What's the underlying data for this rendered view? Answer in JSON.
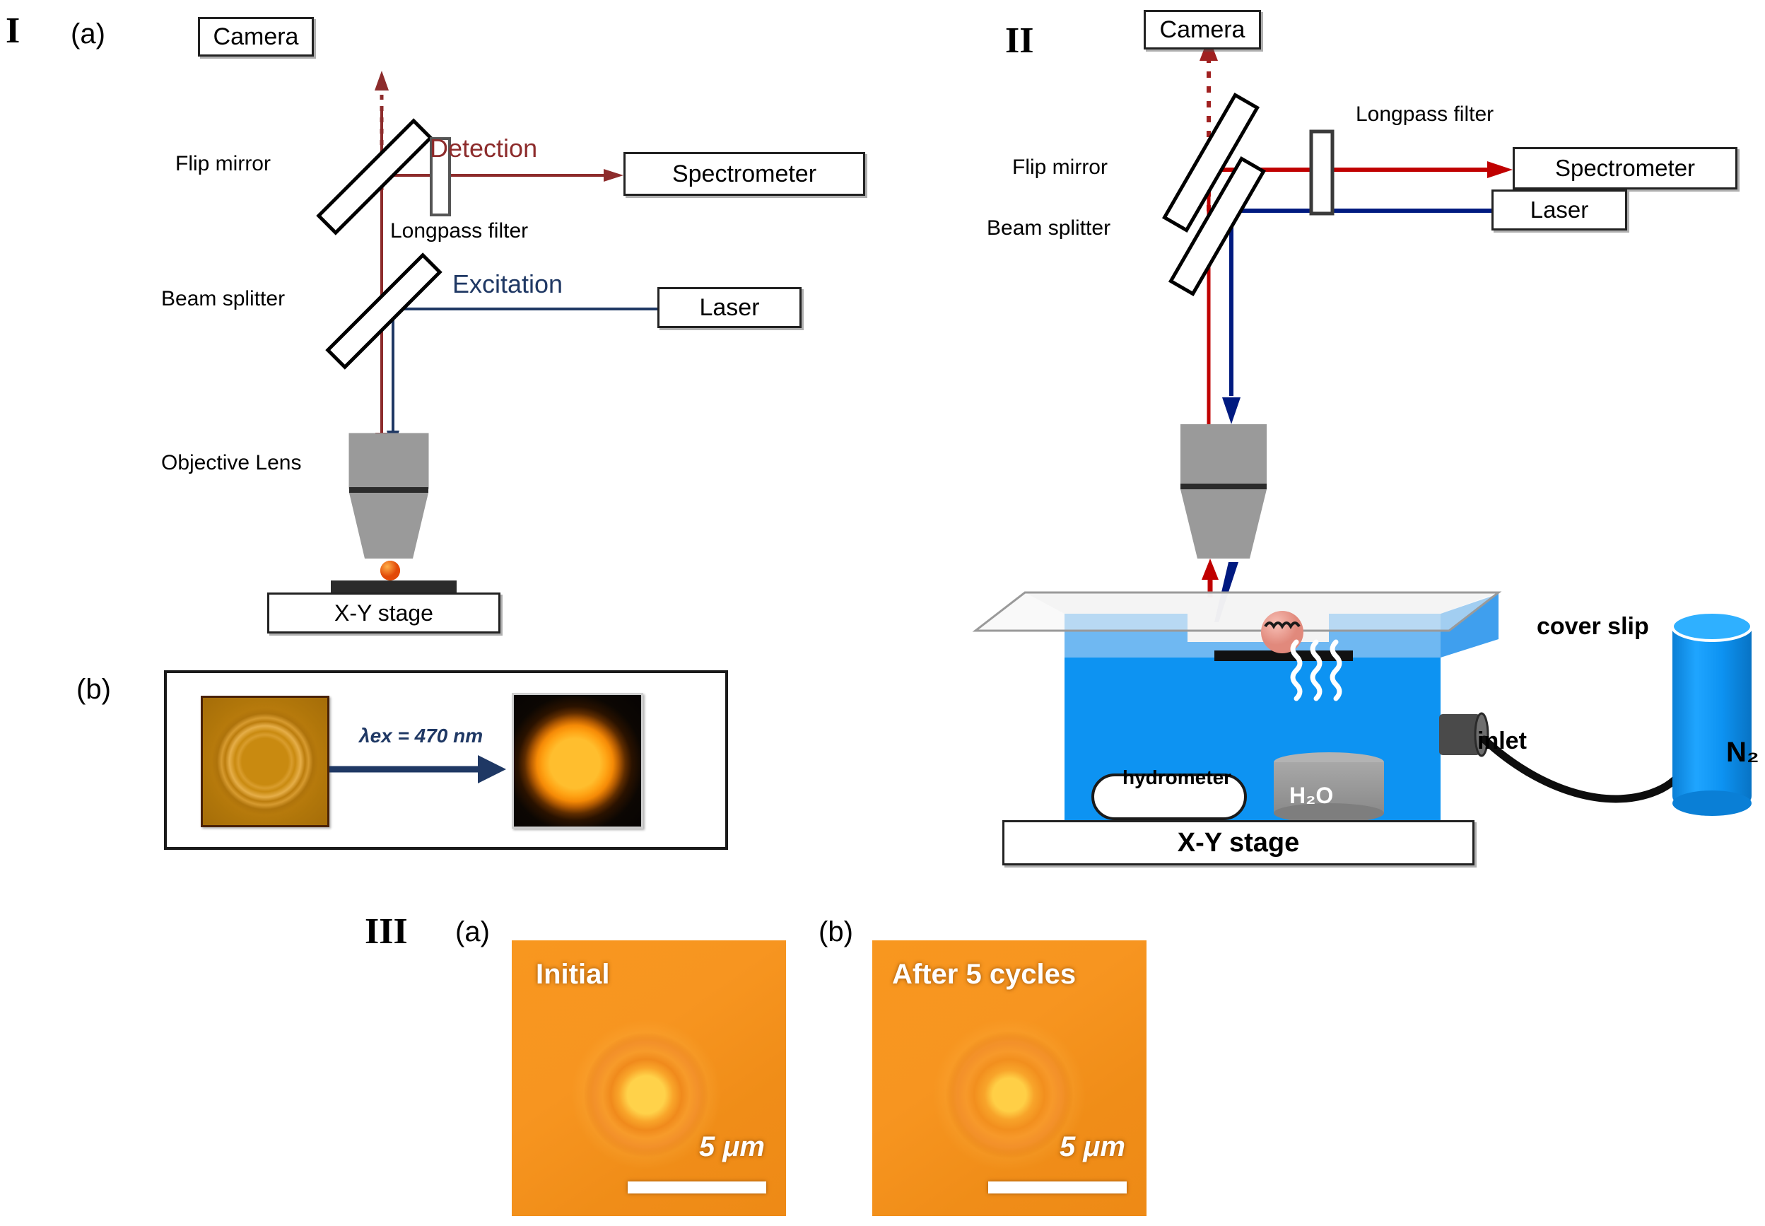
{
  "figure": {
    "panels": [
      {
        "id": "I",
        "roman": "I"
      },
      {
        "id": "II",
        "roman": "II"
      },
      {
        "id": "III",
        "roman": "III"
      }
    ]
  },
  "panel_I": {
    "roman_label": "I",
    "sub_a": "(a)",
    "sub_b": "(b)",
    "components": {
      "camera": "Camera",
      "spectrometer": "Spectrometer",
      "laser": "Laser",
      "flip_mirror": "Flip mirror",
      "beam_splitter": "Beam splitter",
      "longpass_filter": "Longpass filter",
      "objective_lens": "Objective Lens",
      "xy_stage": "X-Y stage"
    },
    "beams": {
      "detection_label": "Detection",
      "excitation_label": "Excitation",
      "detection_color": "#8d2c2c",
      "excitation_color": "#1f3864",
      "camera_beam_color": "#8d2c2c"
    },
    "inset_b": {
      "arrow_label": "λex = 470 nm",
      "arrow_color": "#1f3864",
      "left_image_alt": "bright-field microsphere",
      "right_image_alt": "fluorescence microsphere"
    }
  },
  "panel_II": {
    "roman_label": "II",
    "components": {
      "camera": "Camera",
      "spectrometer": "Spectrometer",
      "laser": "Laser",
      "flip_mirror": "Flip mirror",
      "beam_splitter": "Beam splitter",
      "longpass_filter": "Longpass filter",
      "xy_stage": "X-Y stage"
    },
    "chamber": {
      "cover_slip": "cover slip",
      "inlet": "inlet",
      "hydrometer": "hydrometer",
      "water": "H₂O",
      "gas_cylinder": "N₂",
      "chamber_color": "#0d93f2",
      "chamber_top_color": "#6fb8f2",
      "cylinder_color": "#0d9bff",
      "sample_color": "#ef9f96"
    },
    "beams": {
      "detection_color": "#c00000",
      "excitation_color": "#001a80"
    }
  },
  "panel_III": {
    "roman_label": "III",
    "sub_a": "(a)",
    "sub_b": "(b)",
    "images": [
      {
        "caption": "Initial",
        "scalebar": "5 μm"
      },
      {
        "caption": "After 5 cycles",
        "scalebar": "5 μm"
      }
    ]
  }
}
